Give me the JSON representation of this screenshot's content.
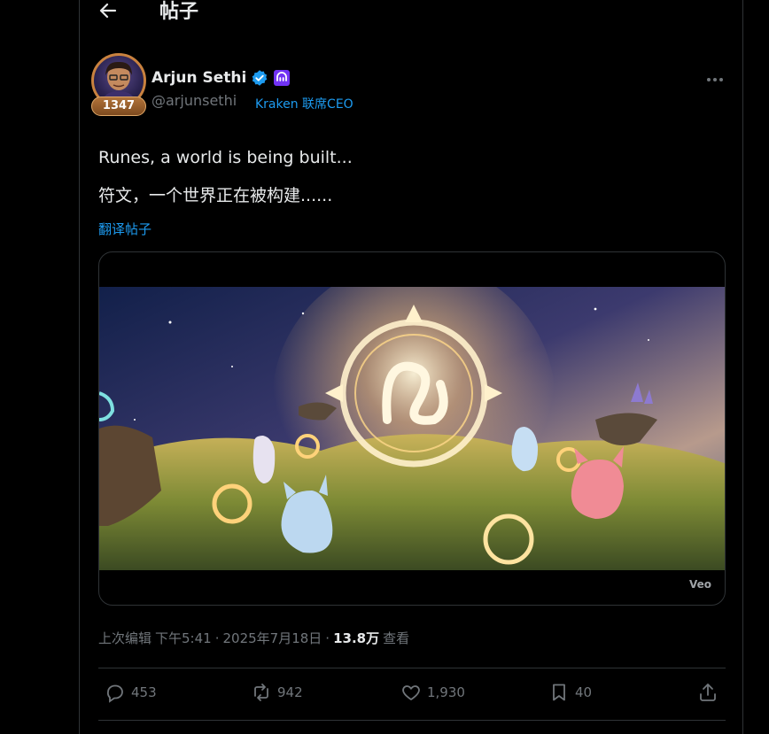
{
  "header": {
    "title": "帖子",
    "back_icon": "arrow-left-icon"
  },
  "author": {
    "display_name": "Arjun Sethi",
    "handle": "@arjunsethi",
    "level": "1347",
    "affiliation": "Kraken 联席CEO",
    "verified_color": "#1d9bf0",
    "affiliate_badge_color": "#7132f5"
  },
  "tweet": {
    "text_en": "Runes, a world is being built...",
    "text_zh": "符文，一个世界正在被构建......",
    "translate_label": "翻译帖子"
  },
  "media": {
    "watermark": "Veo"
  },
  "meta": {
    "edited_label": "上次编辑",
    "time": "下午5:41",
    "sep1": "·",
    "date": "2025年7月18日",
    "sep2": "·",
    "views_count": "13.8万",
    "views_label": "查看"
  },
  "actions": {
    "replies": "453",
    "reposts": "942",
    "likes": "1,930",
    "bookmarks": "40"
  },
  "colors": {
    "accent": "#1d9bf0",
    "muted": "#71767b",
    "text": "#e7e9ea",
    "border": "#2f3336"
  }
}
